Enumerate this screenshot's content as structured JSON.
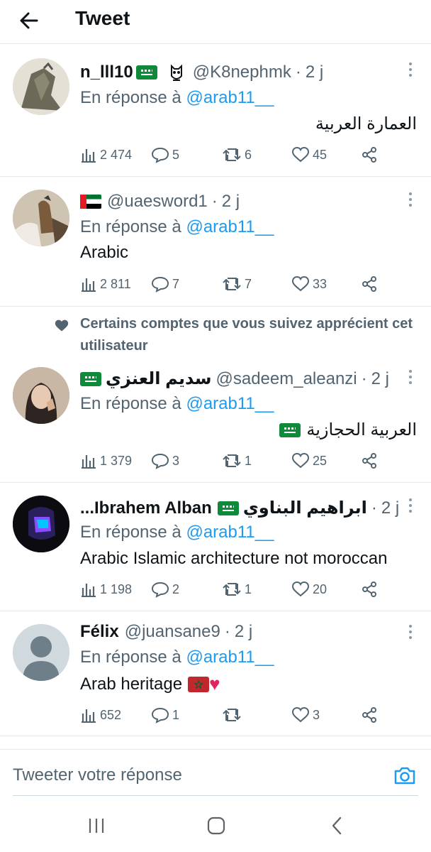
{
  "header": {
    "title": "Tweet"
  },
  "tweets": [
    {
      "name": "n_lll10",
      "handle": "@K8nephmk",
      "dot": "·",
      "time": "2 j",
      "reply_prefix": "En réponse à",
      "reply_to": "@arab11__",
      "text": "العمارة العربية",
      "views": "2 474",
      "replies": "5",
      "retweets": "6",
      "likes": "45"
    },
    {
      "name": "",
      "handle": "@uaesword1",
      "dot": "·",
      "time": "2 j",
      "reply_prefix": "En réponse à",
      "reply_to": "@arab11__",
      "text": "Arabic",
      "views": "2 811",
      "replies": "7",
      "retweets": "7",
      "likes": "33"
    },
    {
      "name": "سديم العنزي",
      "handle": "@sadeem_aleanzi",
      "dot": "·",
      "time": "2 j",
      "reply_prefix": "En réponse à",
      "reply_to": "@arab11__",
      "text": "العربية الحجازية",
      "views": "1 379",
      "replies": "3",
      "retweets": "1",
      "likes": "25"
    },
    {
      "name": "...Ibrahem Alban",
      "name_ar": "ابراهيم البناوي",
      "handle": "",
      "dot": "·",
      "time": "2 j",
      "reply_prefix": "En réponse à",
      "reply_to": "@arab11__",
      "text": "Arabic Islamic architecture not moroccan",
      "views": "1 198",
      "replies": "2",
      "retweets": "1",
      "likes": "20"
    },
    {
      "name": "Félix",
      "handle": "@juansane9",
      "dot": "·",
      "time": "2 j",
      "reply_prefix": "En réponse à",
      "reply_to": "@arab11__",
      "text": "Arab heritage",
      "views": "652",
      "replies": "1",
      "retweets": "",
      "likes": "3"
    }
  ],
  "social_context": "Certains comptes que vous suivez apprécient cet utilisateur",
  "composer": {
    "placeholder": "Tweeter votre réponse"
  },
  "icons": {
    "back": "arrow-left-icon",
    "more": "more-vertical-icon",
    "views": "bar-chart-icon",
    "reply": "comment-icon",
    "retweet": "retweet-icon",
    "like": "heart-icon",
    "share": "share-icon",
    "camera": "camera-icon"
  },
  "colors": {
    "accent": "#1d9bf0",
    "secondary_text": "#536471",
    "divider": "#e7e9ea"
  }
}
